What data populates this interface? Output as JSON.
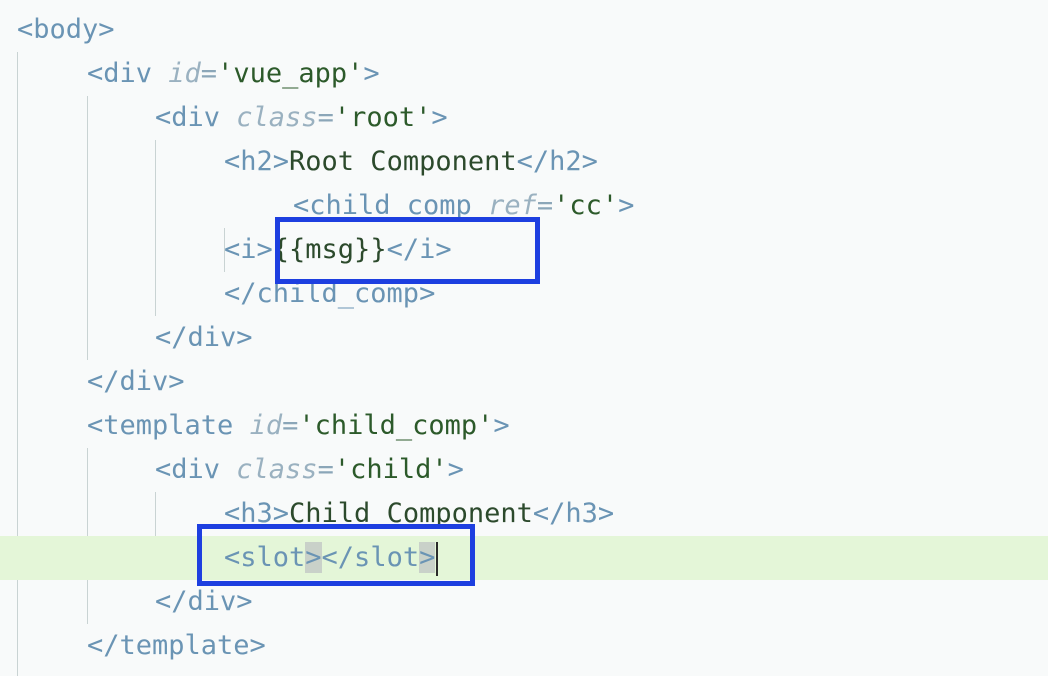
{
  "editor": {
    "lines": [
      {
        "parts": [
          [
            "tag",
            "<body>"
          ]
        ]
      },
      {
        "parts": [
          [
            "tag",
            "<div "
          ],
          [
            "attr",
            "id"
          ],
          [
            "eq",
            "="
          ],
          [
            "str",
            "'vue_app'"
          ],
          [
            "tag",
            ">"
          ]
        ]
      },
      {
        "parts": [
          [
            "tag",
            "<div "
          ],
          [
            "attr",
            "class"
          ],
          [
            "eq",
            "="
          ],
          [
            "str",
            "'root'"
          ],
          [
            "tag",
            ">"
          ]
        ]
      },
      {
        "parts": [
          [
            "tag",
            "<h2>"
          ],
          [
            "txt",
            "Root Component"
          ],
          [
            "tag",
            "</h2>"
          ]
        ]
      },
      {
        "parts": [
          [
            "tag",
            "<child_comp "
          ],
          [
            "attr",
            "ref"
          ],
          [
            "eq",
            "="
          ],
          [
            "str",
            "'cc'"
          ],
          [
            "tag",
            ">"
          ]
        ]
      },
      {
        "parts": [
          [
            "tag",
            "<i>"
          ],
          [
            "txt",
            "{{msg}}"
          ],
          [
            "tag",
            "</i>"
          ]
        ]
      },
      {
        "parts": [
          [
            "tag",
            "</child_comp>"
          ]
        ]
      },
      {
        "parts": [
          [
            "tag",
            "</div>"
          ]
        ]
      },
      {
        "parts": [
          [
            "tag",
            "</div>"
          ]
        ]
      },
      {
        "parts": [
          [
            "tag",
            "<template "
          ],
          [
            "attr",
            "id"
          ],
          [
            "eq",
            "="
          ],
          [
            "str",
            "'child_comp'"
          ],
          [
            "tag",
            ">"
          ]
        ]
      },
      {
        "parts": [
          [
            "tag",
            "<div "
          ],
          [
            "attr",
            "class"
          ],
          [
            "eq",
            "="
          ],
          [
            "str",
            "'child'"
          ],
          [
            "tag",
            ">"
          ]
        ]
      },
      {
        "parts": [
          [
            "tag",
            "<h3>"
          ],
          [
            "txt",
            "Child Component"
          ],
          [
            "tag",
            "</h3>"
          ]
        ]
      },
      {
        "parts": [
          [
            "tag",
            "<slot"
          ],
          [
            "bracket",
            ">"
          ],
          [
            "tag",
            "</slot"
          ],
          [
            "bracket",
            ">"
          ]
        ]
      },
      {
        "parts": [
          [
            "tag",
            "</div>"
          ]
        ]
      },
      {
        "parts": [
          [
            "tag",
            "</template>"
          ]
        ]
      }
    ],
    "active_line_index": 12
  }
}
